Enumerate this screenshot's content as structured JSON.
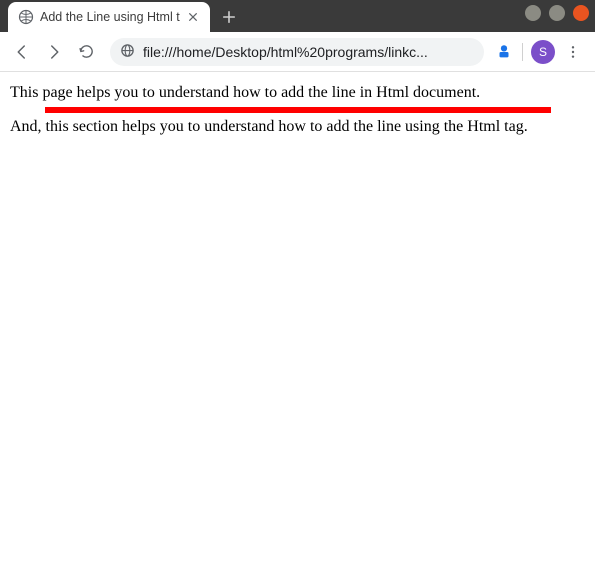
{
  "window": {
    "tab": {
      "title": "Add the Line using Html t"
    },
    "avatar_letter": "S"
  },
  "addressbar": {
    "url": "file:///home/Desktop/html%20programs/linkc..."
  },
  "page": {
    "text1": "This page helps you to understand how to add the line in Html document.",
    "text2": "And, this section helps you to understand how to add the line using the Html tag.",
    "hr_color": "#ff0000"
  }
}
